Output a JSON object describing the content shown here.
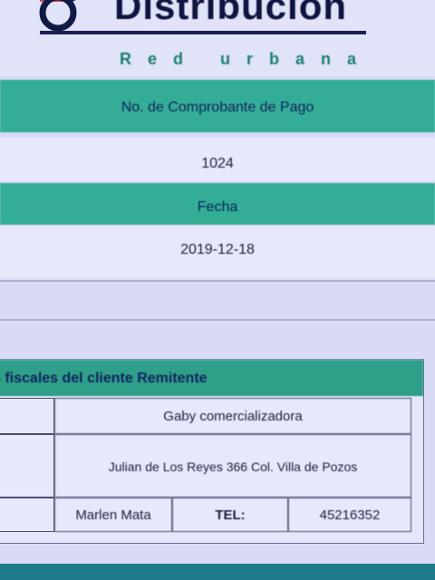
{
  "brand": {
    "name": "Distribución",
    "tagline": "Red urbana"
  },
  "receipt": {
    "comprobante_label": "No. de Comprobante de Pago",
    "comprobante_value": "1024",
    "fecha_label": "Fecha",
    "fecha_value": "2019-12-18"
  },
  "client": {
    "header": "s fiscales del cliente Remitente",
    "name": "Gaby comercializadora",
    "address": "Julian de Los Reyes 366 Col. Villa de Pozos",
    "contact": "Marlen Mata",
    "tel_label": "TEL:",
    "tel_value": "45216352"
  },
  "colors": {
    "accent_teal": "#34ad97",
    "brand_navy": "#0d1440",
    "tagline_green": "#1b7f6f",
    "background": "#d9dbf6"
  }
}
